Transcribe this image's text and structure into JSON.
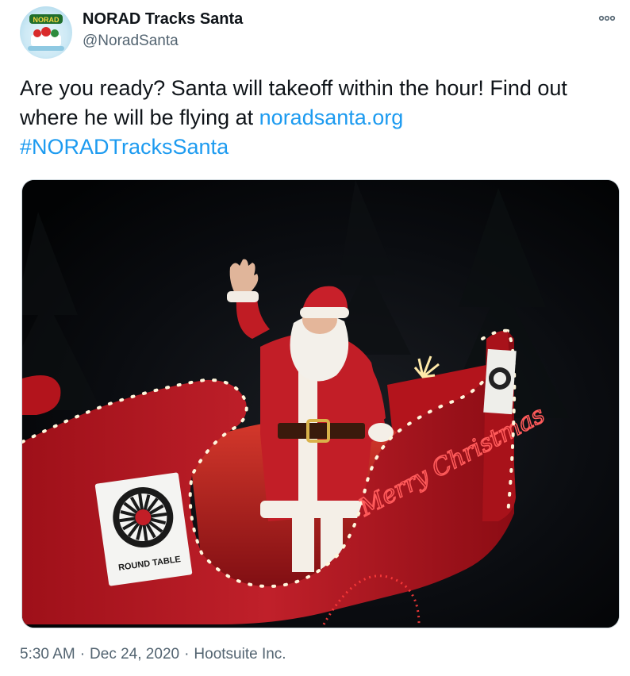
{
  "author": {
    "display_name": "NORAD Tracks Santa",
    "handle": "@NoradSanta",
    "avatar_text": "NORAD"
  },
  "tweet": {
    "text_part1": "Are you ready? Santa will takeoff within the hour! Find out where he will be flying at ",
    "link": "noradsanta.org",
    "hashtag": "#NORADTracksSanta"
  },
  "media": {
    "sign_text": "ROUND TABLE",
    "sleigh_text": "Merry Christmas"
  },
  "meta": {
    "time": "5:30 AM",
    "separator": "·",
    "date": "Dec 24, 2020",
    "source": "Hootsuite Inc."
  },
  "colors": {
    "text": "#0f1419",
    "secondary": "#536471",
    "link": "#1d9bf0",
    "sleigh_red": "#b3141c"
  },
  "icons": [
    "more-options-icon"
  ]
}
